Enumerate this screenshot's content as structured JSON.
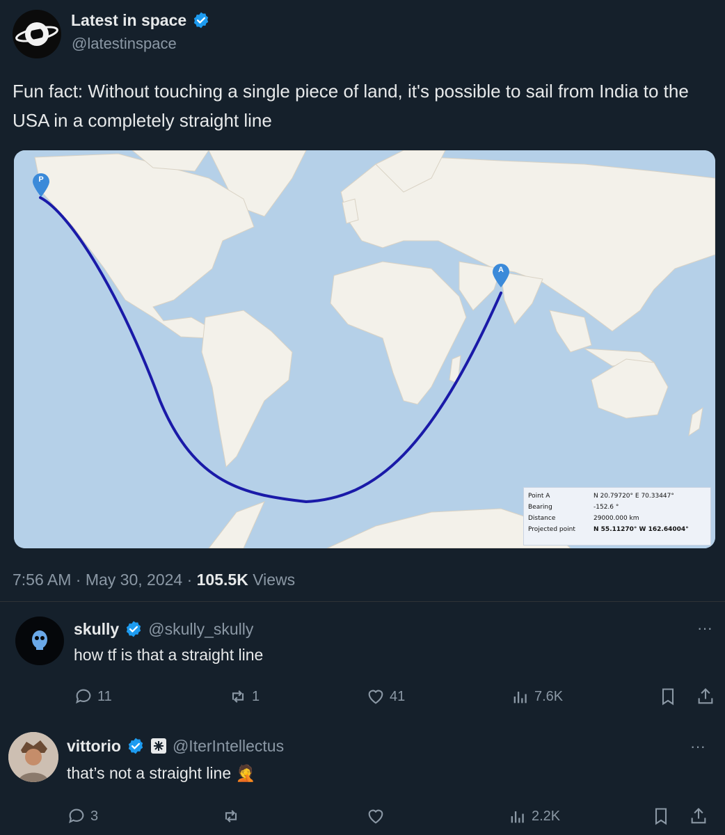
{
  "post": {
    "author_name": "Latest in space",
    "author_handle": "@latestinspace",
    "text": "Fun fact: Without touching a single piece of land, it's possible to sail from India to the USA in a completely straight line",
    "timestamp": "7:56 AM · May 30, 2024 · ",
    "views_count": "105.5K",
    "views_label": "Views"
  },
  "map": {
    "marker_a": "A",
    "marker_b": "P",
    "info": {
      "rows": [
        {
          "label": "Point A",
          "value": "N 20.79720° E 70.33447°"
        },
        {
          "label": "Bearing",
          "value": "-152.6 °"
        },
        {
          "label": "Distance",
          "value": "29000.000 km"
        },
        {
          "label": "Projected point",
          "value": "N 55.11270° W 162.64004°"
        }
      ]
    }
  },
  "replies": [
    {
      "name": "skully",
      "handle": "@skully_skully",
      "text": "how tf is that a straight line",
      "reply_count": "11",
      "repost_count": "1",
      "like_count": "41",
      "view_count": "7.6K"
    },
    {
      "name": "vittorio",
      "handle": "@IterIntellectus",
      "text": "that’s not a straight line 🤦",
      "reply_count": "3",
      "repost_count": "",
      "like_count": "",
      "view_count": "2.2K"
    }
  ],
  "colors": {
    "background": "#15202b",
    "verified": "#1d9bf0",
    "route": "#1a1aa8",
    "ocean": "#b5d0e8",
    "land": "#f3f1ea"
  }
}
